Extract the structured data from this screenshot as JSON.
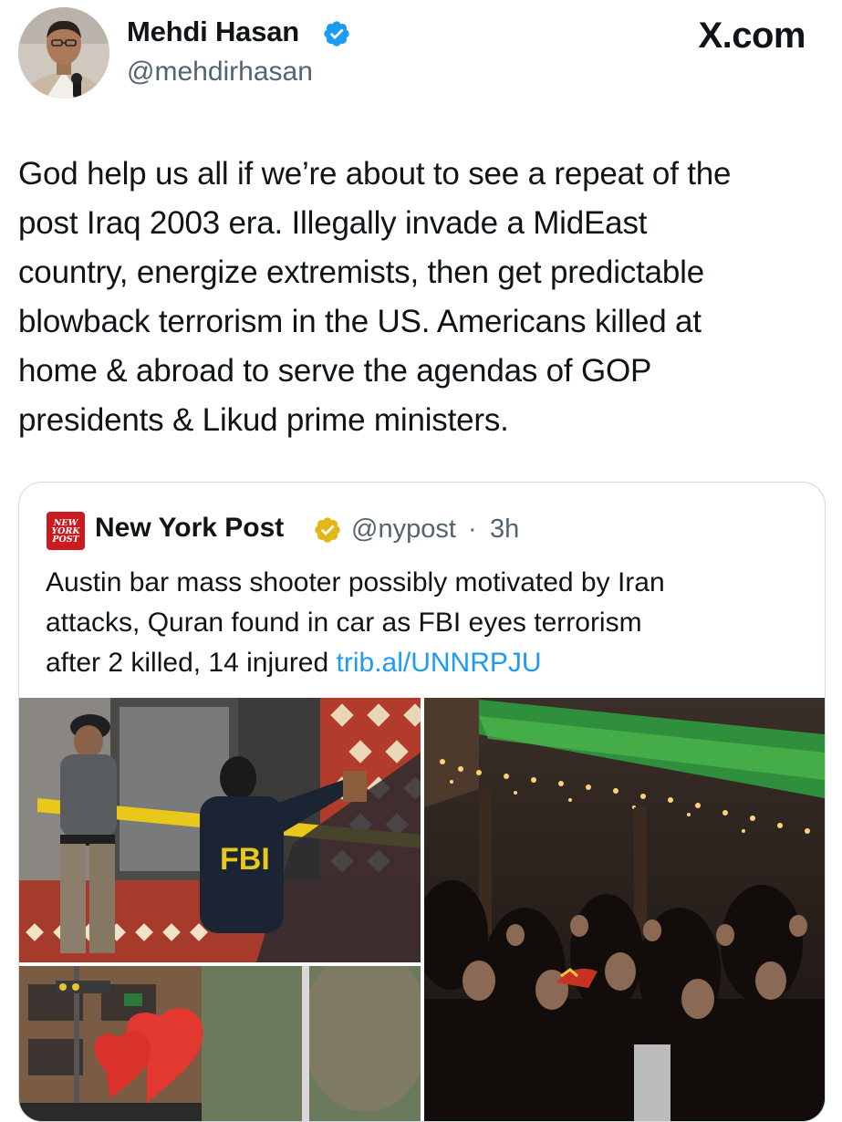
{
  "author": {
    "name": "Mehdi Hasan",
    "handle": "@mehdirhasan",
    "verified": true
  },
  "site_label": "X.com",
  "tweet": {
    "lines": [
      "God help us all if we’re about to see a repeat of the",
      "post Iraq 2003 era. Illegally invade a MidEast",
      "country, energize extremists, then get predictable",
      "blowback terrorism in the US. Americans killed at",
      "home & abroad to serve the agendas of GOP",
      "presidents & Likud prime ministers."
    ]
  },
  "quoted": {
    "logo_lines": [
      "NEW",
      "YORK",
      "POST"
    ],
    "name": "New York Post",
    "handle": "@nypost",
    "separator": "·",
    "time": "3h",
    "lines": [
      "Austin bar mass shooter possibly motivated by Iran",
      "attacks, Quran found in car as FBI eyes terrorism",
      "after 2 killed, 14 injured "
    ],
    "link": "trib.al/UNNRPJU",
    "photo_labels": {
      "fbi_jacket": "FBI"
    }
  },
  "colors": {
    "text": "#0f1419",
    "secondary": "#536471",
    "link": "#1d9bf0",
    "verified_blue": "#1d9bf0",
    "verified_gold": "#e2b719",
    "nypost_red": "#cc1a21",
    "border": "#cfd9de"
  },
  "icons": {
    "author_badge": "verified-blue-icon",
    "quoted_badge": "verified-gold-icon"
  }
}
